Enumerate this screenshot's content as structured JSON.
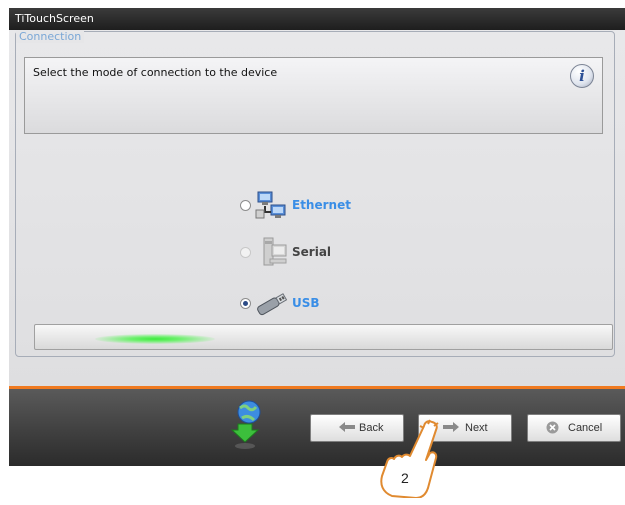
{
  "window": {
    "title": "TiTouchScreen"
  },
  "group": {
    "legend": "Connection"
  },
  "info": {
    "message": "Select the mode of connection to the device",
    "icon": "info-icon"
  },
  "options": [
    {
      "label": "Ethernet",
      "selected": false,
      "enabled": true,
      "color": "#3a8ee6",
      "icon": "network-computers-icon"
    },
    {
      "label": "Serial",
      "selected": false,
      "enabled": false,
      "color": "#444444",
      "icon": "serial-computer-icon"
    },
    {
      "label": "USB",
      "selected": true,
      "enabled": true,
      "color": "#3a8ee6",
      "icon": "usb-icon"
    }
  ],
  "footer": {
    "back_label": "Back",
    "next_label": "Next",
    "cancel_label": "Cancel",
    "step_number": "2"
  },
  "colors": {
    "accent": "#f07a20",
    "link_blue": "#3a8ee6",
    "title_bar": "#2a2a2a"
  }
}
